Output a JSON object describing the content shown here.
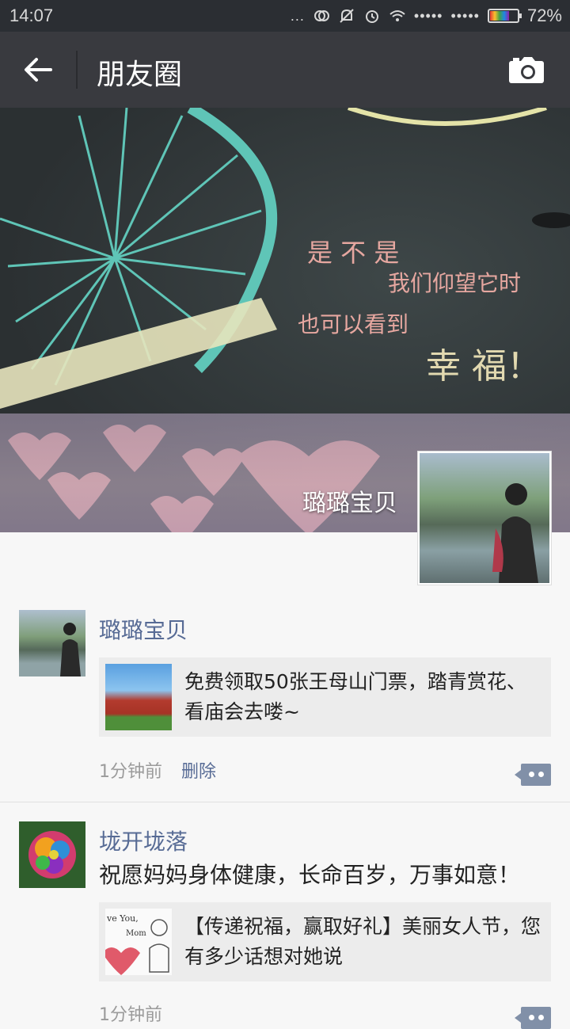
{
  "status_bar": {
    "time": "14:07",
    "signal_dots_1": "•••••",
    "signal_dots_2": "•••••",
    "battery_percent": "72%",
    "battery_level": 0.72,
    "more": "..."
  },
  "header": {
    "title": "朋友圈",
    "back_icon": "arrow-left-icon",
    "camera_icon": "camera-icon"
  },
  "cover": {
    "line1": "是 不 是",
    "line2": "我们仰望它时",
    "line3": "也可以看到",
    "line4": "幸 福！",
    "owner_name": "璐璐宝贝"
  },
  "posts": [
    {
      "name": "璐璐宝贝",
      "text": "",
      "share_desc": "免费领取50张王母山门票，踏青赏花、看庙会去喽~",
      "time": "1分钟前",
      "delete_label": "删除"
    },
    {
      "name": "垅开垅落",
      "text": "祝愿妈妈身体健康，长命百岁，万事如意！",
      "share_desc": "【传递祝福，赢取好礼】美丽女人节，您有多少话想对她说",
      "thumb_text_1": "ve You,",
      "thumb_text_2": "Mom",
      "time": "1分钟前"
    }
  ],
  "colors": {
    "title_bar": "#393a3f",
    "status_bar": "#2b2e33",
    "link_blue": "#576b95",
    "share_bg": "#ececec"
  }
}
